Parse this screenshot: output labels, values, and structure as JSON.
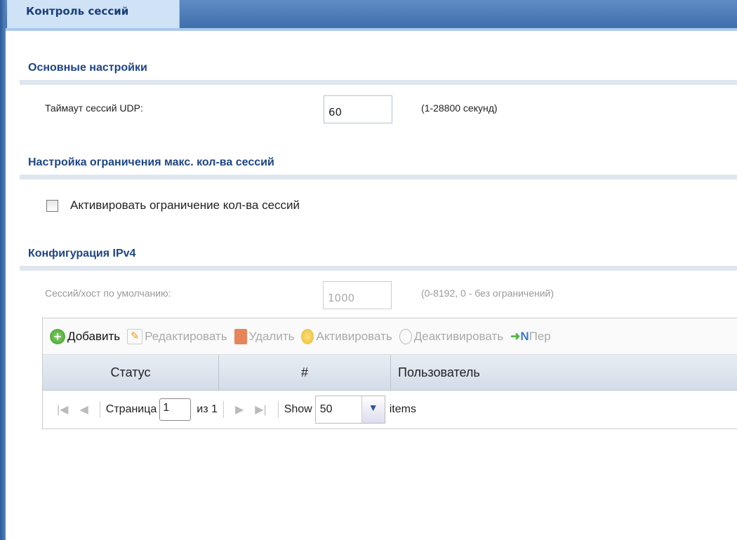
{
  "tab": {
    "title": "Контроль сессий"
  },
  "basic": {
    "title": "Основные настройки",
    "udp_label": "Таймаут сессий UDP:",
    "udp_value": "60",
    "udp_hint": "(1-28800 секунд)"
  },
  "limit": {
    "title": "Настройка ограничения макс. кол-ва сессий",
    "checkbox_label": "Активировать ограничение кол-ва сессий",
    "checked": false
  },
  "ipv4": {
    "title": "Конфигурация IPv4",
    "default_label": "Сессий/хост по умолчанию:",
    "default_value": "1000",
    "default_hint": "(0-8192, 0 - без ограничений)"
  },
  "toolbar": {
    "add": "Добавить",
    "edit": "Редактировать",
    "delete": "Удалить",
    "activate": "Активировать",
    "deactivate": "Деактивировать",
    "move": "Пер"
  },
  "table": {
    "columns": [
      "Статус",
      "#",
      "Пользователь"
    ]
  },
  "pager": {
    "page_label": "Страница",
    "page": "1",
    "of": "из 1",
    "show": "Show",
    "per_page": "50",
    "items": "items"
  }
}
